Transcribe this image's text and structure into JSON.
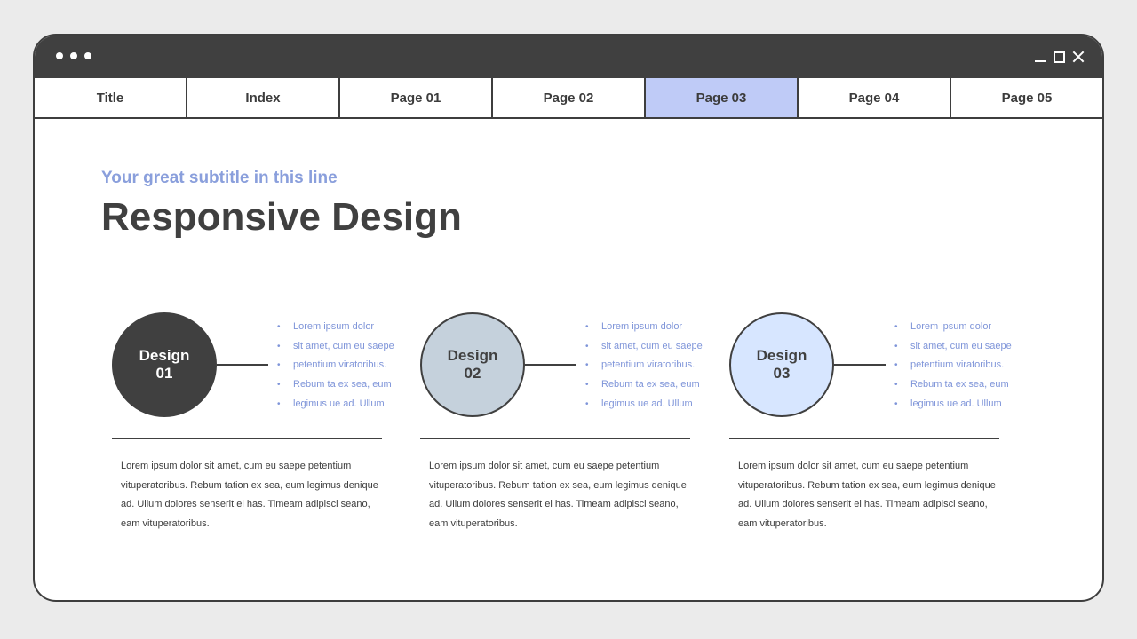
{
  "window": {
    "tabs": [
      {
        "label": "Title"
      },
      {
        "label": "Index"
      },
      {
        "label": "Page 01"
      },
      {
        "label": "Page 02"
      },
      {
        "label": "Page 03",
        "active": true
      },
      {
        "label": "Page 04"
      },
      {
        "label": "Page 05"
      }
    ]
  },
  "slide": {
    "subtitle": "Your great subtitle in this line",
    "title": "Responsive Design"
  },
  "designs": [
    {
      "name_line1": "Design",
      "name_line2": "01",
      "circle_color": "#404040",
      "text_color": "#ffffff",
      "bullets": [
        "Lorem ipsum dolor",
        "sit amet, cum eu saepe",
        "petentium viratoribus.",
        "Rebum ta ex sea, eum",
        "legimus ue ad. Ullum"
      ],
      "paragraph": "Lorem ipsum dolor sit amet, cum eu saepe petentium vituperatoribus. Rebum tation ex sea, eum legimus denique ad. Ullum dolores senserit ei has. Timeam adipisci seano, eam vituperatoribus."
    },
    {
      "name_line1": "Design",
      "name_line2": "02",
      "circle_color": "#c5d1dc",
      "text_color": "#404040",
      "bullets": [
        "Lorem ipsum dolor",
        "sit amet, cum eu saepe",
        "petentium viratoribus.",
        "Rebum ta ex sea, eum",
        "legimus ue ad. Ullum"
      ],
      "paragraph": "Lorem ipsum dolor sit amet, cum eu saepe petentium vituperatoribus. Rebum tation ex sea, eum legimus denique ad. Ullum dolores senserit ei has. Timeam adipisci seano, eam vituperatoribus."
    },
    {
      "name_line1": "Design",
      "name_line2": "03",
      "circle_color": "#d7e6ff",
      "text_color": "#404040",
      "bullets": [
        "Lorem ipsum dolor",
        "sit amet, cum eu saepe",
        "petentium viratoribus.",
        "Rebum ta ex sea, eum",
        "legimus ue ad. Ullum"
      ],
      "paragraph": "Lorem ipsum dolor sit amet, cum eu saepe petentium vituperatoribus. Rebum tation ex sea, eum legimus denique ad. Ullum dolores senserit ei has. Timeam adipisci seano, eam vituperatoribus."
    }
  ],
  "colors": {
    "accent": "#8a9fdc",
    "active_tab": "#bfcbf7",
    "dark": "#404040"
  }
}
